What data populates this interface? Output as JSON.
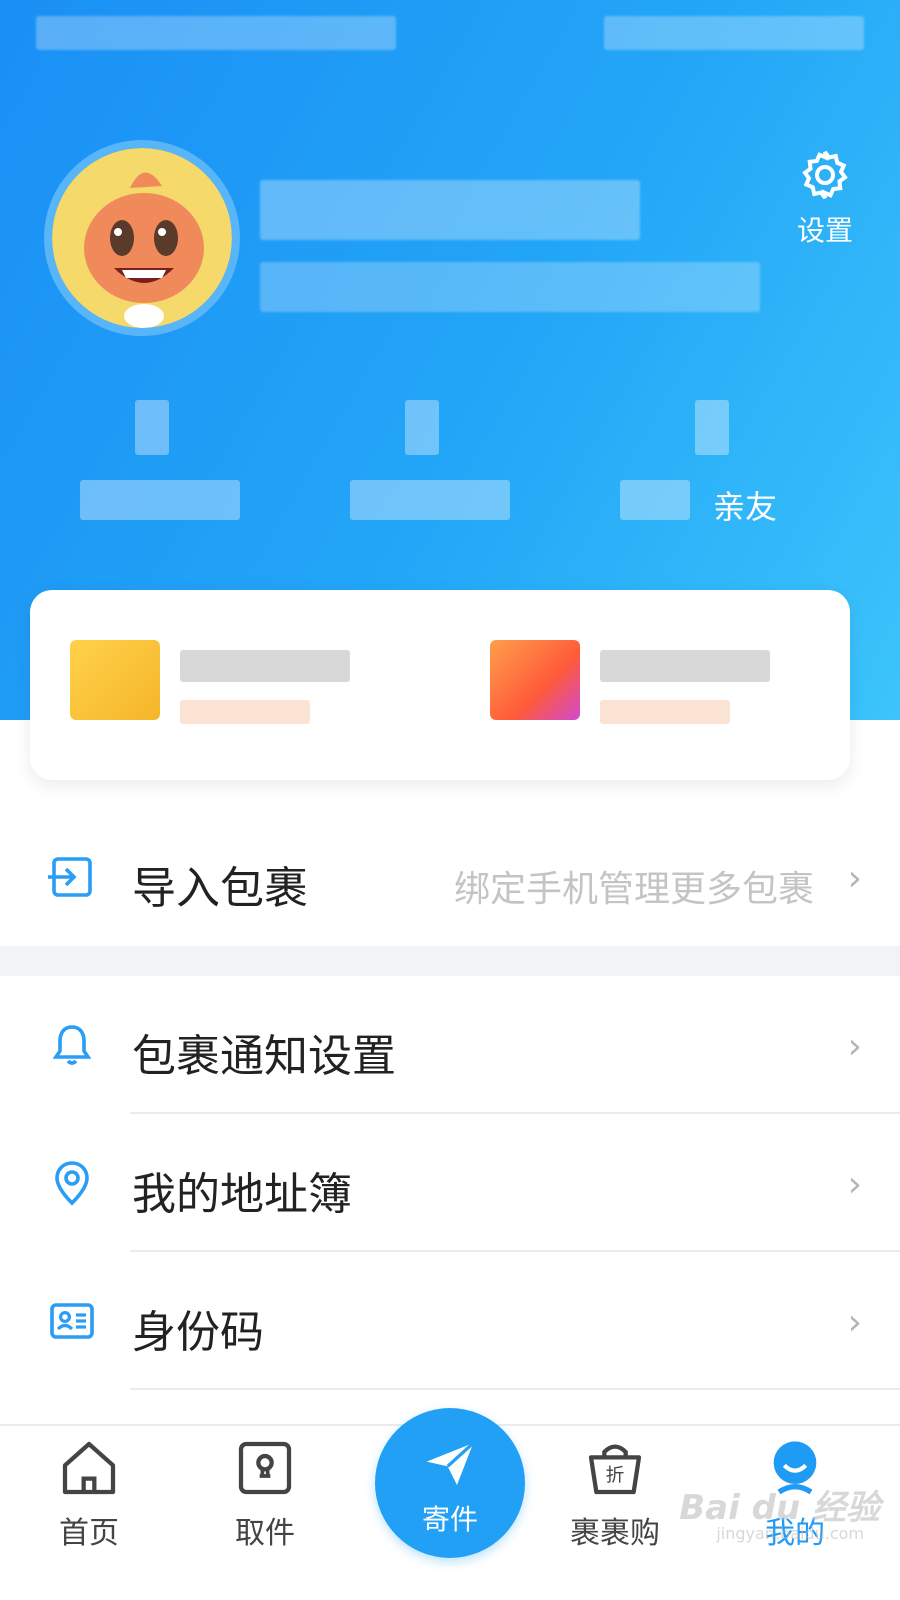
{
  "header": {
    "settings_label": "设置",
    "stats": [
      {
        "label": ""
      },
      {
        "label": ""
      },
      {
        "label": "亲友"
      }
    ]
  },
  "menu": {
    "import": {
      "label": "导入包裹",
      "hint": "绑定手机管理更多包裹"
    },
    "notify": {
      "label": "包裹通知设置"
    },
    "address": {
      "label": "我的地址簿"
    },
    "idcode": {
      "label": "身份码"
    }
  },
  "chevron": "›",
  "tabbar": {
    "home": "首页",
    "pickup": "取件",
    "send": "寄件",
    "shop": "裹裹购",
    "mine": "我的"
  },
  "watermark": {
    "main": "Bai du 经验",
    "sub": "jingyan.baidu.com"
  },
  "colors": {
    "accent": "#1f9af5",
    "header_start": "#1a8ff5",
    "header_end": "#3cc4fb",
    "send_button": "#22a0f6"
  },
  "icons": {
    "settings": "gear-icon",
    "import": "import-box-icon",
    "notify": "bell-icon",
    "address": "location-pin-icon",
    "idcode": "id-card-icon",
    "home": "house-icon",
    "pickup": "locker-icon",
    "send": "paper-plane-icon",
    "shop": "shopping-bag-icon",
    "mine": "user-icon"
  }
}
